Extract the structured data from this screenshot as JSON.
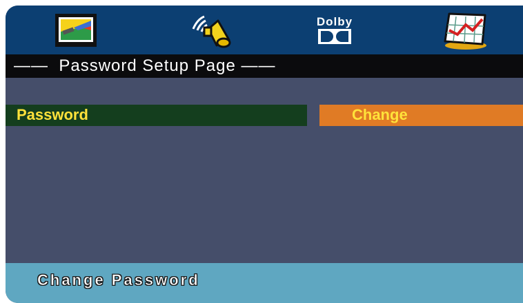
{
  "toolbar": {
    "icons": [
      {
        "name": "general-setup-icon"
      },
      {
        "name": "audio-setup-icon"
      },
      {
        "name": "dolby-icon",
        "label": "Dolby"
      },
      {
        "name": "preference-icon"
      }
    ]
  },
  "title": "——  Password Setup Page ——",
  "password_row": {
    "label": "Password",
    "button": "Change"
  },
  "status": "Change Password",
  "colors": {
    "toolbar": "#0c3f72",
    "title_bar": "#0b0b0d",
    "content": "#454e6a",
    "label_box": "#143e1e",
    "button": "#e07b25",
    "text_yellow": "#ffe23a",
    "status_bar": "#5fa7c1"
  }
}
